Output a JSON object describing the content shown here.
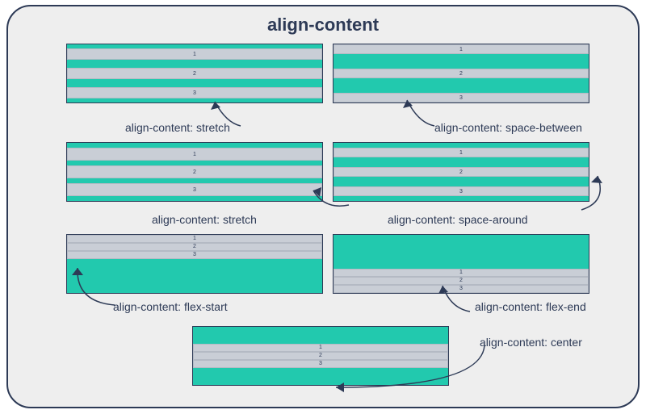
{
  "title": "align-content",
  "examples": [
    {
      "caption": "align-content: stretch",
      "rows": [
        "1",
        "2",
        "3"
      ]
    },
    {
      "caption": "align-content: space-between",
      "rows": [
        "1",
        "2",
        "3"
      ]
    },
    {
      "caption": "align-content: stretch",
      "rows": [
        "1",
        "2",
        "3"
      ]
    },
    {
      "caption": "align-content: space-around",
      "rows": [
        "1",
        "2",
        "3"
      ]
    },
    {
      "caption": "align-content: flex-start",
      "rows": [
        "1",
        "2",
        "3"
      ]
    },
    {
      "caption": "align-content: flex-end",
      "rows": [
        "1",
        "2",
        "3"
      ]
    },
    {
      "caption": "align-content: center",
      "rows": [
        "1",
        "2",
        "3"
      ]
    }
  ]
}
